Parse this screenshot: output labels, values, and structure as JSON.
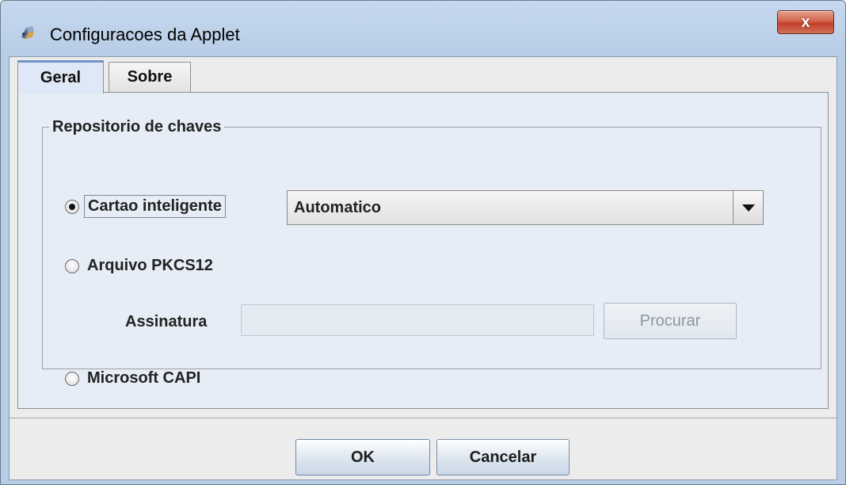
{
  "window": {
    "title": "Configuracoes da Applet",
    "close_label": "x"
  },
  "tabs": [
    {
      "label": "Geral",
      "selected": true
    },
    {
      "label": "Sobre",
      "selected": false
    }
  ],
  "group": {
    "title": "Repositorio de chaves",
    "options": [
      {
        "label": "Cartao inteligente",
        "selected": true
      },
      {
        "label": "Arquivo PKCS12",
        "selected": false
      },
      {
        "label": "Microsoft CAPI",
        "selected": false
      }
    ],
    "combo_value": "Automatico",
    "assinatura_label": "Assinatura",
    "assinatura_value": "",
    "procurar_label": "Procurar"
  },
  "buttons": {
    "ok": "OK",
    "cancel": "Cancelar"
  },
  "colors": {
    "title_bar": "#c5d8ee",
    "close_button": "#c2402a",
    "panel": "#e6edf6"
  },
  "icons": {
    "app": "java-applet-icon",
    "close": "close-icon",
    "dropdown": "chevron-down-icon"
  }
}
